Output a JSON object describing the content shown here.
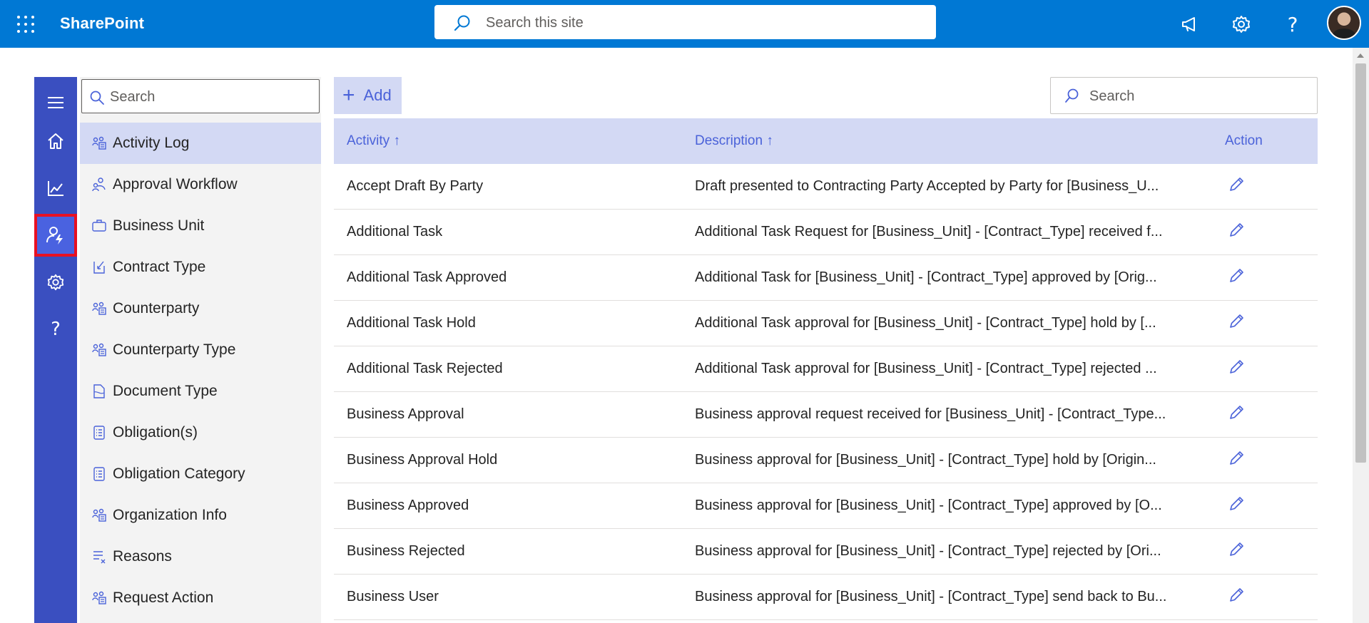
{
  "header": {
    "app_name": "SharePoint",
    "search_placeholder": "Search this site",
    "help_glyph": "?"
  },
  "rail": {
    "items": [
      {
        "icon": "hamburger-menu-icon"
      },
      {
        "icon": "home-icon"
      },
      {
        "icon": "chart-icon"
      },
      {
        "icon": "user-settings-icon",
        "active": true
      },
      {
        "icon": "gear-icon"
      },
      {
        "icon": "help-icon",
        "glyph": "?"
      }
    ]
  },
  "menu": {
    "search_placeholder": "Search",
    "items": [
      {
        "label": "Activity Log",
        "icon": "people-group-icon",
        "selected": true
      },
      {
        "label": "Approval Workflow",
        "icon": "people-flow-icon"
      },
      {
        "label": "Business Unit",
        "icon": "briefcase-icon"
      },
      {
        "label": "Contract Type",
        "icon": "contract-icon"
      },
      {
        "label": "Counterparty",
        "icon": "people-group-icon"
      },
      {
        "label": "Counterparty Type",
        "icon": "people-group-icon"
      },
      {
        "label": "Document Type",
        "icon": "document-icon"
      },
      {
        "label": "Obligation(s)",
        "icon": "checklist-icon"
      },
      {
        "label": "Obligation Category",
        "icon": "checklist-icon"
      },
      {
        "label": "Organization Info",
        "icon": "people-group-icon"
      },
      {
        "label": "Reasons",
        "icon": "list-x-icon"
      },
      {
        "label": "Request Action",
        "icon": "people-group-icon"
      }
    ]
  },
  "toolbar": {
    "add_label": "Add",
    "search_placeholder": "Search"
  },
  "table": {
    "columns": [
      "Activity",
      "Description",
      "Action"
    ],
    "sort_arrow": "↑",
    "rows": [
      {
        "activity": "Accept Draft By Party",
        "description": "Draft presented to Contracting Party Accepted by Party for [Business_U..."
      },
      {
        "activity": "Additional Task",
        "description": "Additional Task Request for [Business_Unit] - [Contract_Type] received f..."
      },
      {
        "activity": "Additional Task Approved",
        "description": "Additional Task for [Business_Unit] - [Contract_Type] approved by [Orig..."
      },
      {
        "activity": "Additional Task Hold",
        "description": "Additional Task approval for [Business_Unit] - [Contract_Type] hold by [..."
      },
      {
        "activity": "Additional Task Rejected",
        "description": "Additional Task approval for [Business_Unit] - [Contract_Type] rejected ..."
      },
      {
        "activity": "Business Approval",
        "description": "Business approval request received for [Business_Unit] - [Contract_Type..."
      },
      {
        "activity": "Business Approval Hold",
        "description": "Business approval for [Business_Unit] - [Contract_Type] hold by [Origin..."
      },
      {
        "activity": "Business Approved",
        "description": "Business approval for [Business_Unit] - [Contract_Type] approved by [O..."
      },
      {
        "activity": "Business Rejected",
        "description": "Business approval for [Business_Unit] - [Contract_Type] rejected by [Ori..."
      },
      {
        "activity": "Business User",
        "description": "Business approval for [Business_Unit] - [Contract_Type] send back to Bu..."
      }
    ]
  },
  "colors": {
    "topbar": "#0078d4",
    "rail": "#3a4fc0",
    "accent": "#4a62d9",
    "header_row": "#d3d9f4",
    "highlight_outline": "#e81123"
  }
}
